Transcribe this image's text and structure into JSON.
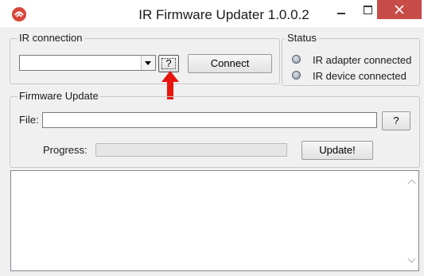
{
  "window": {
    "title": "IR Firmware Updater 1.0.0.2",
    "accent_color": "#c74b47",
    "icon": "app-logo-icon"
  },
  "ir_connection": {
    "group_label": "IR connection",
    "port_value": "",
    "help_label": "?",
    "connect_label": "Connect"
  },
  "status": {
    "group_label": "Status",
    "items": [
      {
        "label": "IR adapter connected",
        "icon": "status-led-icon"
      },
      {
        "label": "IR device connected",
        "icon": "status-led-icon"
      }
    ]
  },
  "firmware_update": {
    "group_label": "Firmware Update",
    "file_label": "File:",
    "file_value": "",
    "file_help_label": "?",
    "progress_label": "Progress:",
    "progress_value": 0,
    "update_label": "Update!"
  },
  "log": {
    "content": ""
  },
  "annotation": {
    "icon": "red-arrow-up-icon",
    "color": "#e8150f"
  }
}
